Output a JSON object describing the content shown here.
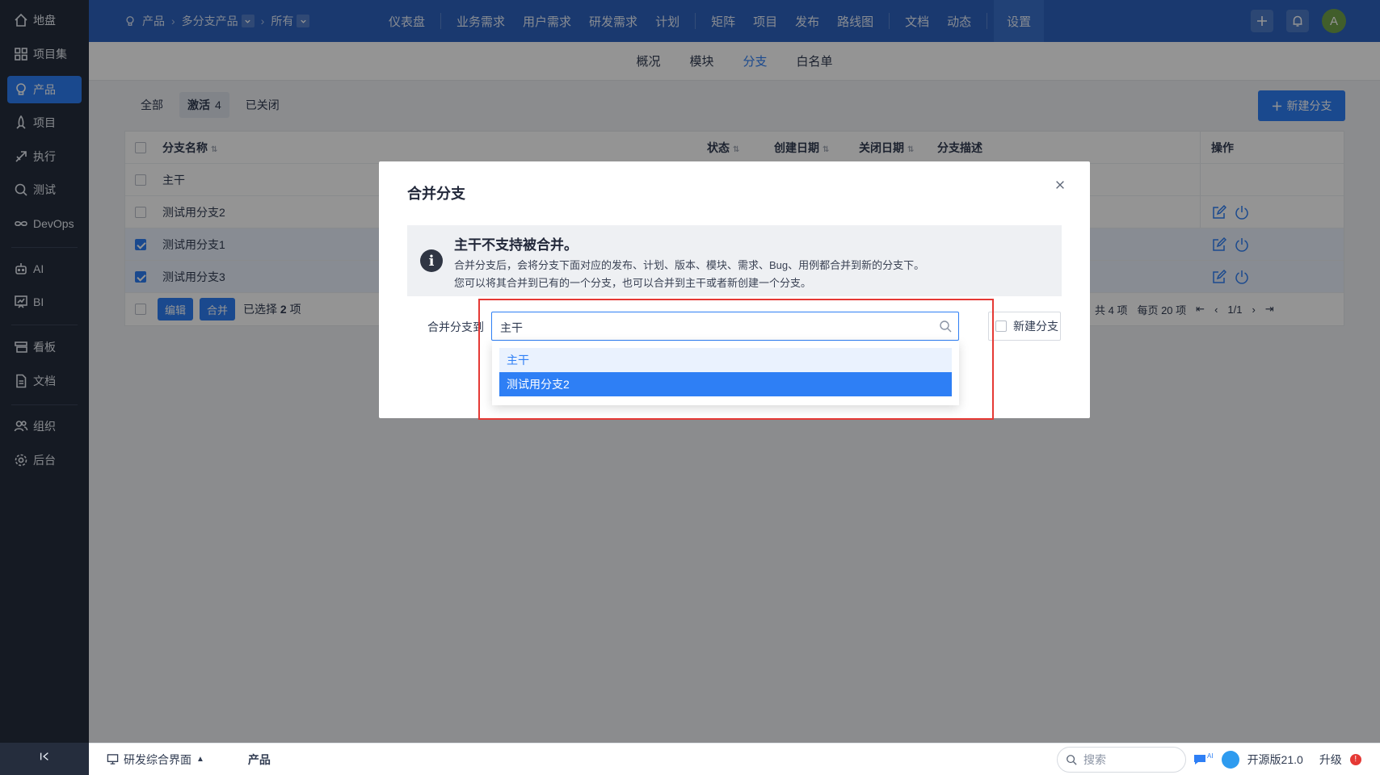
{
  "sidebar": {
    "items": [
      {
        "label": "地盘",
        "icon": "home-icon"
      },
      {
        "label": "项目集",
        "icon": "grid-icon"
      },
      {
        "label": "产品",
        "icon": "lightbulb-icon"
      },
      {
        "label": "项目",
        "icon": "rocket-icon"
      },
      {
        "label": "执行",
        "icon": "run-icon"
      },
      {
        "label": "测试",
        "icon": "bug-search-icon"
      },
      {
        "label": "DevOps",
        "icon": "infinity-icon"
      },
      {
        "label": "AI",
        "icon": "robot-icon"
      },
      {
        "label": "BI",
        "icon": "chart-board-icon"
      },
      {
        "label": "看板",
        "icon": "kanban-icon"
      },
      {
        "label": "文档",
        "icon": "document-icon"
      },
      {
        "label": "组织",
        "icon": "people-icon"
      },
      {
        "label": "后台",
        "icon": "gear-icon"
      }
    ],
    "active_index": 2
  },
  "topbar": {
    "breadcrumb": {
      "root": "产品",
      "product": "多分支产品",
      "branch": "所有"
    },
    "nav": [
      "仪表盘",
      "业务需求",
      "用户需求",
      "研发需求",
      "计划",
      "矩阵",
      "项目",
      "发布",
      "路线图",
      "文档",
      "动态",
      "设置"
    ],
    "active_nav": "设置",
    "avatar_letter": "A"
  },
  "subnav": {
    "items": [
      "概况",
      "模块",
      "分支",
      "白名单"
    ],
    "active": "分支"
  },
  "filters": {
    "all": "全部",
    "active": "激活",
    "active_count": "4",
    "closed": "已关闭"
  },
  "new_branch_button": "新建分支",
  "table": {
    "headers": {
      "name": "分支名称",
      "status": "状态",
      "created": "创建日期",
      "closed": "关闭日期",
      "desc": "分支描述",
      "actions": "操作"
    },
    "rows": [
      {
        "name": "主干",
        "checked": false
      },
      {
        "name": "测试用分支2",
        "checked": false
      },
      {
        "name": "测试用分支1",
        "checked": true
      },
      {
        "name": "测试用分支3",
        "checked": true
      }
    ],
    "footer": {
      "edit_button": "编辑",
      "merge_button": "合并",
      "selected_text": "已选择",
      "selected_count": "2",
      "selected_unit": "项",
      "total": "共 4 项",
      "per_page": "每页 20 项",
      "page": "1/1"
    }
  },
  "modal": {
    "title": "合并分支",
    "alert_title": "主干不支持被合并。",
    "alert_line1": "合并分支后，会将分支下面对应的发布、计划、版本、模块、需求、Bug、用例都合并到新的分支下。",
    "alert_line2": "您可以将其合并到已有的一个分支，也可以合并到主干或者新创建一个分支。",
    "field_label": "合并分支到",
    "picker_value": "主干",
    "new_branch_label": "新建分支",
    "options": [
      "主干",
      "测试用分支2"
    ]
  },
  "statusbar": {
    "workspace": "研发综合界面",
    "current": "产品",
    "search_placeholder": "搜索",
    "ai_badge": "AI",
    "version": "开源版21.0",
    "upgrade": "升级",
    "upgrade_badge": "!"
  },
  "colors": {
    "primary": "#2e7ff5",
    "topbar": "#2e63bf",
    "sidebar": "#252d3d",
    "highlight_box": "#e53935"
  }
}
